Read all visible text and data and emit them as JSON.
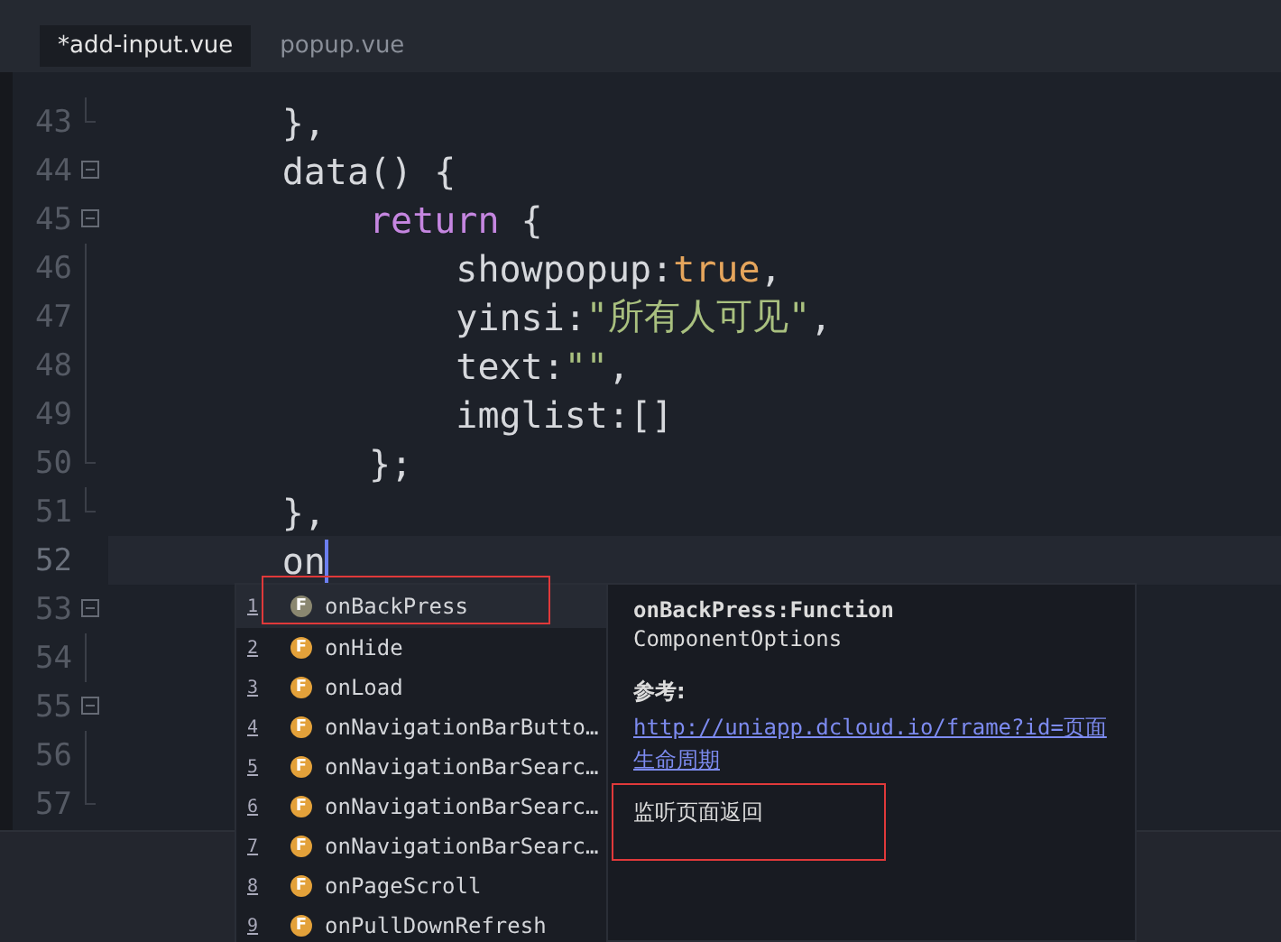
{
  "tabs": [
    {
      "label": "*add-input.vue",
      "selected": true
    },
    {
      "label": "popup.vue",
      "selected": false
    }
  ],
  "editor": {
    "lines": [
      {
        "number": "43",
        "kind": "end",
        "current": false,
        "tokens": [
          {
            "kind": "plain",
            "text": "        },"
          }
        ]
      },
      {
        "number": "44",
        "kind": "fold",
        "current": false,
        "tokens": [
          {
            "kind": "plain",
            "text": "        data() {"
          }
        ]
      },
      {
        "number": "45",
        "kind": "fold",
        "current": false,
        "tokens": [
          {
            "kind": "keyword",
            "text": "            return"
          },
          {
            "kind": "plain",
            "text": " {"
          }
        ]
      },
      {
        "number": "46",
        "kind": "line",
        "current": false,
        "tokens": [
          {
            "kind": "plain",
            "text": "                showpopup:"
          },
          {
            "kind": "literal",
            "text": "true"
          },
          {
            "kind": "plain",
            "text": ","
          }
        ]
      },
      {
        "number": "47",
        "kind": "line",
        "current": false,
        "tokens": [
          {
            "kind": "plain",
            "text": "                yinsi:"
          },
          {
            "kind": "string",
            "text": "\"所有人可见\""
          },
          {
            "kind": "plain",
            "text": ","
          }
        ]
      },
      {
        "number": "48",
        "kind": "line",
        "current": false,
        "tokens": [
          {
            "kind": "plain",
            "text": "                text:"
          },
          {
            "kind": "string",
            "text": "\"\""
          },
          {
            "kind": "plain",
            "text": ","
          }
        ]
      },
      {
        "number": "49",
        "kind": "line",
        "current": false,
        "tokens": [
          {
            "kind": "plain",
            "text": "                imglist:[]"
          }
        ]
      },
      {
        "number": "50",
        "kind": "end",
        "current": false,
        "tokens": [
          {
            "kind": "plain",
            "text": "            };"
          }
        ]
      },
      {
        "number": "51",
        "kind": "end",
        "current": false,
        "tokens": [
          {
            "kind": "plain",
            "text": "        },"
          }
        ]
      },
      {
        "number": "52",
        "kind": "plain",
        "current": true,
        "tokens": [
          {
            "kind": "plain",
            "text": "        on"
          }
        ]
      },
      {
        "number": "53",
        "kind": "fold",
        "current": false
      },
      {
        "number": "54",
        "kind": "line",
        "current": false
      },
      {
        "number": "55",
        "kind": "fold",
        "current": false
      },
      {
        "number": "56",
        "kind": "line",
        "current": false
      },
      {
        "number": "57",
        "kind": "end",
        "current": false
      }
    ]
  },
  "completion": {
    "items": [
      {
        "index": "1",
        "icon": "F",
        "label": "onBackPress",
        "selected": true,
        "highlighted": true
      },
      {
        "index": "2",
        "icon": "F",
        "label": "onHide",
        "selected": false,
        "highlighted": false
      },
      {
        "index": "3",
        "icon": "F",
        "label": "onLoad",
        "selected": false,
        "highlighted": false
      },
      {
        "index": "4",
        "icon": "F",
        "label": "onNavigationBarButto…",
        "selected": false,
        "highlighted": false
      },
      {
        "index": "5",
        "icon": "F",
        "label": "onNavigationBarSearc…",
        "selected": false,
        "highlighted": false
      },
      {
        "index": "6",
        "icon": "F",
        "label": "onNavigationBarSearc…",
        "selected": false,
        "highlighted": false
      },
      {
        "index": "7",
        "icon": "F",
        "label": "onNavigationBarSearc…",
        "selected": false,
        "highlighted": false
      },
      {
        "index": "8",
        "icon": "F",
        "label": "onPageScroll",
        "selected": false,
        "highlighted": false
      },
      {
        "index": "9",
        "icon": "F",
        "label": "onPullDownRefresh",
        "selected": false,
        "highlighted": false
      }
    ],
    "detail": {
      "signature": "onBackPress:Function",
      "type": "ComponentOptions",
      "reference_label": "参考:",
      "link": "http://uniapp.dcloud.io/frame?id=页面生命周期",
      "description": "监听页面返回",
      "description_highlighted": true
    }
  }
}
